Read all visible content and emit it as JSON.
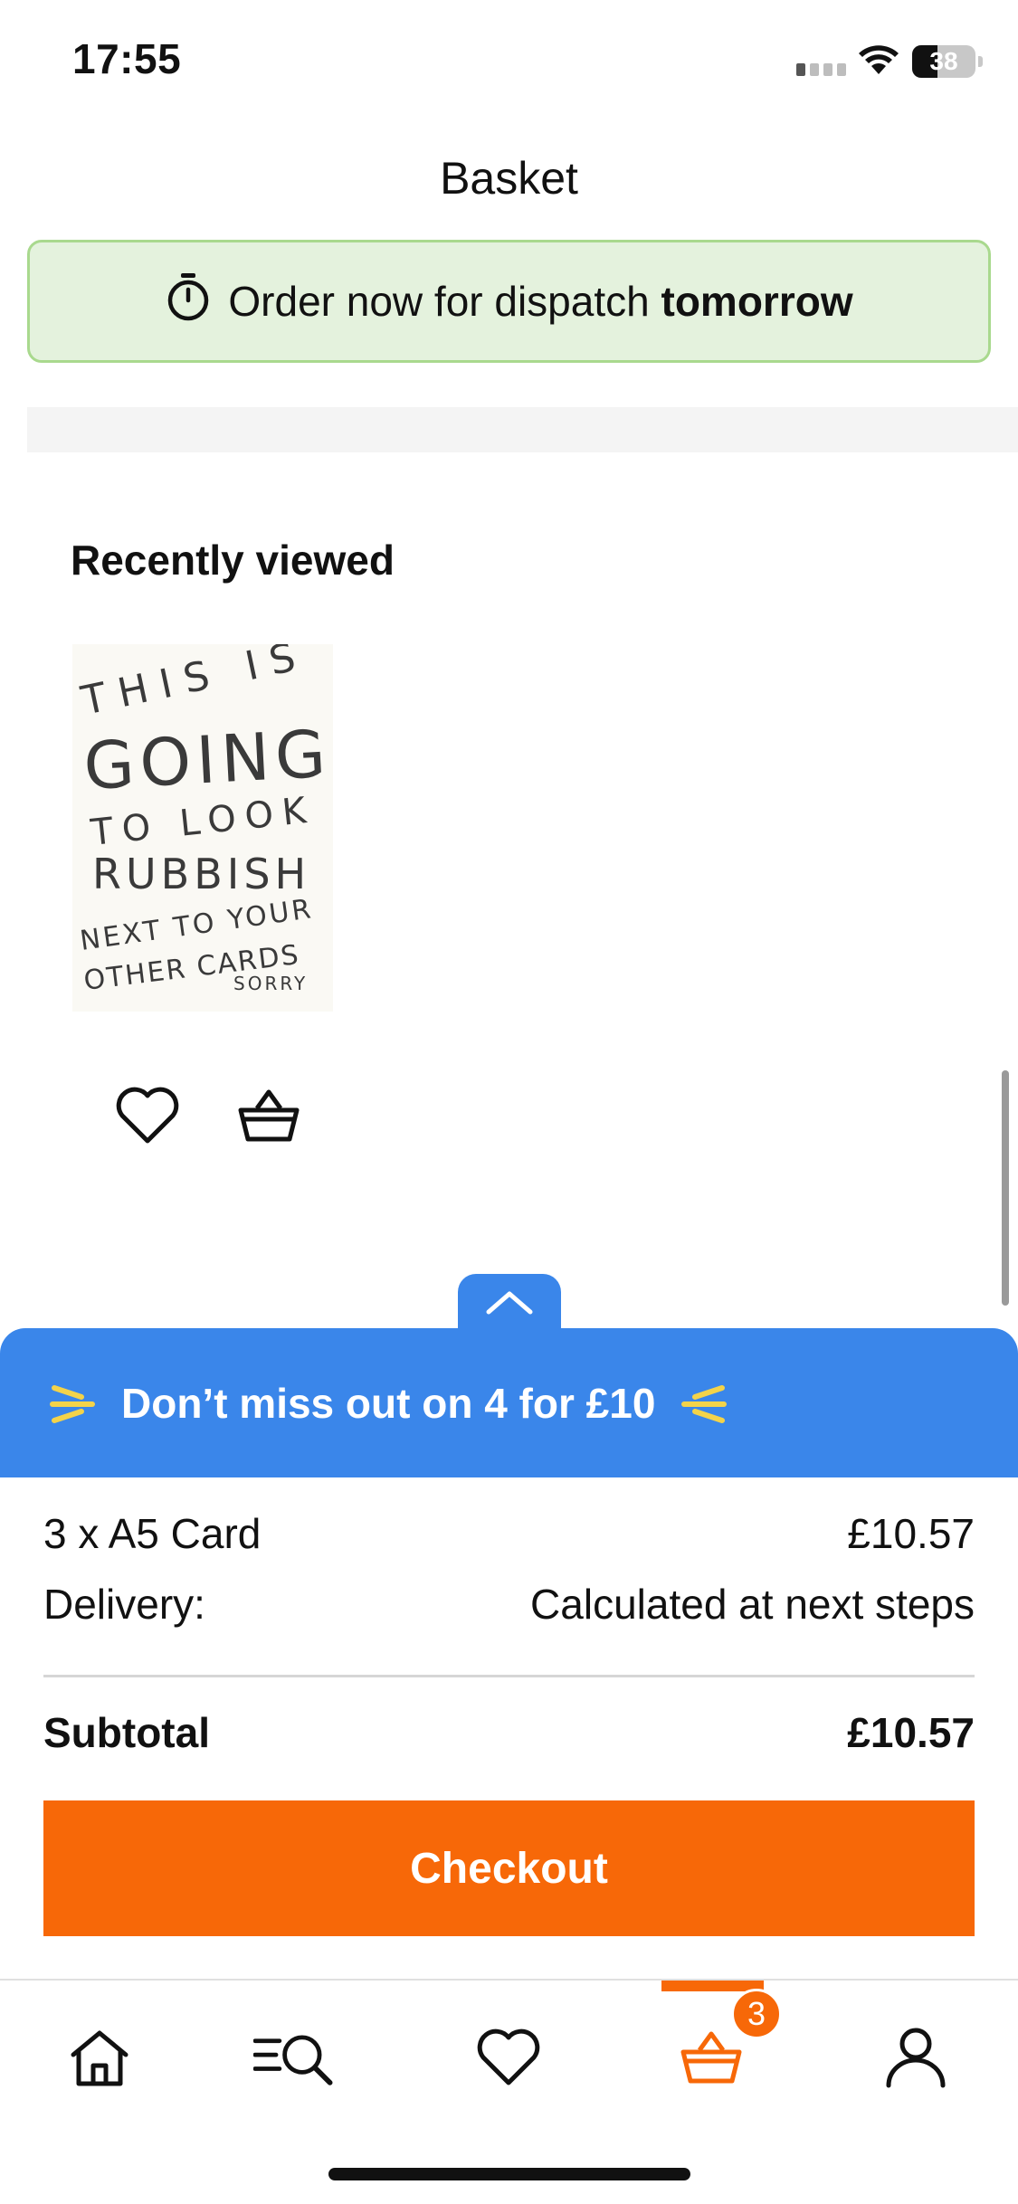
{
  "status_bar": {
    "time": "17:55",
    "battery": "38"
  },
  "header": {
    "title": "Basket"
  },
  "dispatch_banner": {
    "text": "Order now for dispatch",
    "emphasis": "tomorrow"
  },
  "recently_viewed": {
    "title": "Recently viewed",
    "card_lines": [
      "THIS IS",
      "GOING",
      "TO LOOK",
      "RUBBISH",
      "NEXT TO YOUR",
      "OTHER CARDS",
      "SORRY"
    ]
  },
  "promo": {
    "text": "Don’t miss out on 4 for £10"
  },
  "summary": {
    "items_label": "3 x A5 Card",
    "items_price": "£10.57",
    "delivery_label": "Delivery:",
    "delivery_value": "Calculated at next steps",
    "subtotal_label": "Subtotal",
    "subtotal_value": "£10.57"
  },
  "checkout": {
    "label": "Checkout"
  },
  "tab_bar": {
    "items": [
      "home",
      "search",
      "favourites",
      "basket",
      "account"
    ],
    "basket_count": "3",
    "active": "basket"
  },
  "colors": {
    "accent": "#f76808",
    "promo_blue": "#3a86ea",
    "banner_green": "#e4f2dd",
    "banner_border": "#a9d98e"
  },
  "icons": [
    "timer-icon",
    "heart-icon",
    "basket-icon",
    "chevron-up-icon",
    "sparkle-icon",
    "home-icon",
    "search-menu-icon",
    "account-icon"
  ]
}
